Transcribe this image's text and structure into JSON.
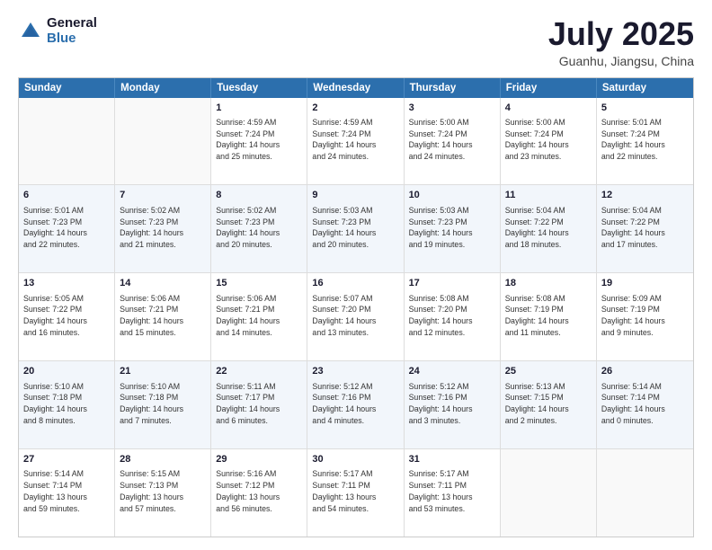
{
  "header": {
    "logo_general": "General",
    "logo_blue": "Blue",
    "title": "July 2025",
    "subtitle": "Guanhu, Jiangsu, China"
  },
  "calendar": {
    "days_of_week": [
      "Sunday",
      "Monday",
      "Tuesday",
      "Wednesday",
      "Thursday",
      "Friday",
      "Saturday"
    ],
    "weeks": [
      [
        {
          "day": "",
          "empty": true,
          "lines": []
        },
        {
          "day": "",
          "empty": true,
          "lines": []
        },
        {
          "day": "1",
          "lines": [
            "Sunrise: 4:59 AM",
            "Sunset: 7:24 PM",
            "Daylight: 14 hours",
            "and 25 minutes."
          ]
        },
        {
          "day": "2",
          "lines": [
            "Sunrise: 4:59 AM",
            "Sunset: 7:24 PM",
            "Daylight: 14 hours",
            "and 24 minutes."
          ]
        },
        {
          "day": "3",
          "lines": [
            "Sunrise: 5:00 AM",
            "Sunset: 7:24 PM",
            "Daylight: 14 hours",
            "and 24 minutes."
          ]
        },
        {
          "day": "4",
          "lines": [
            "Sunrise: 5:00 AM",
            "Sunset: 7:24 PM",
            "Daylight: 14 hours",
            "and 23 minutes."
          ]
        },
        {
          "day": "5",
          "lines": [
            "Sunrise: 5:01 AM",
            "Sunset: 7:24 PM",
            "Daylight: 14 hours",
            "and 22 minutes."
          ]
        }
      ],
      [
        {
          "day": "6",
          "lines": [
            "Sunrise: 5:01 AM",
            "Sunset: 7:23 PM",
            "Daylight: 14 hours",
            "and 22 minutes."
          ]
        },
        {
          "day": "7",
          "lines": [
            "Sunrise: 5:02 AM",
            "Sunset: 7:23 PM",
            "Daylight: 14 hours",
            "and 21 minutes."
          ]
        },
        {
          "day": "8",
          "lines": [
            "Sunrise: 5:02 AM",
            "Sunset: 7:23 PM",
            "Daylight: 14 hours",
            "and 20 minutes."
          ]
        },
        {
          "day": "9",
          "lines": [
            "Sunrise: 5:03 AM",
            "Sunset: 7:23 PM",
            "Daylight: 14 hours",
            "and 20 minutes."
          ]
        },
        {
          "day": "10",
          "lines": [
            "Sunrise: 5:03 AM",
            "Sunset: 7:23 PM",
            "Daylight: 14 hours",
            "and 19 minutes."
          ]
        },
        {
          "day": "11",
          "lines": [
            "Sunrise: 5:04 AM",
            "Sunset: 7:22 PM",
            "Daylight: 14 hours",
            "and 18 minutes."
          ]
        },
        {
          "day": "12",
          "lines": [
            "Sunrise: 5:04 AM",
            "Sunset: 7:22 PM",
            "Daylight: 14 hours",
            "and 17 minutes."
          ]
        }
      ],
      [
        {
          "day": "13",
          "lines": [
            "Sunrise: 5:05 AM",
            "Sunset: 7:22 PM",
            "Daylight: 14 hours",
            "and 16 minutes."
          ]
        },
        {
          "day": "14",
          "lines": [
            "Sunrise: 5:06 AM",
            "Sunset: 7:21 PM",
            "Daylight: 14 hours",
            "and 15 minutes."
          ]
        },
        {
          "day": "15",
          "lines": [
            "Sunrise: 5:06 AM",
            "Sunset: 7:21 PM",
            "Daylight: 14 hours",
            "and 14 minutes."
          ]
        },
        {
          "day": "16",
          "lines": [
            "Sunrise: 5:07 AM",
            "Sunset: 7:20 PM",
            "Daylight: 14 hours",
            "and 13 minutes."
          ]
        },
        {
          "day": "17",
          "lines": [
            "Sunrise: 5:08 AM",
            "Sunset: 7:20 PM",
            "Daylight: 14 hours",
            "and 12 minutes."
          ]
        },
        {
          "day": "18",
          "lines": [
            "Sunrise: 5:08 AM",
            "Sunset: 7:19 PM",
            "Daylight: 14 hours",
            "and 11 minutes."
          ]
        },
        {
          "day": "19",
          "lines": [
            "Sunrise: 5:09 AM",
            "Sunset: 7:19 PM",
            "Daylight: 14 hours",
            "and 9 minutes."
          ]
        }
      ],
      [
        {
          "day": "20",
          "lines": [
            "Sunrise: 5:10 AM",
            "Sunset: 7:18 PM",
            "Daylight: 14 hours",
            "and 8 minutes."
          ]
        },
        {
          "day": "21",
          "lines": [
            "Sunrise: 5:10 AM",
            "Sunset: 7:18 PM",
            "Daylight: 14 hours",
            "and 7 minutes."
          ]
        },
        {
          "day": "22",
          "lines": [
            "Sunrise: 5:11 AM",
            "Sunset: 7:17 PM",
            "Daylight: 14 hours",
            "and 6 minutes."
          ]
        },
        {
          "day": "23",
          "lines": [
            "Sunrise: 5:12 AM",
            "Sunset: 7:16 PM",
            "Daylight: 14 hours",
            "and 4 minutes."
          ]
        },
        {
          "day": "24",
          "lines": [
            "Sunrise: 5:12 AM",
            "Sunset: 7:16 PM",
            "Daylight: 14 hours",
            "and 3 minutes."
          ]
        },
        {
          "day": "25",
          "lines": [
            "Sunrise: 5:13 AM",
            "Sunset: 7:15 PM",
            "Daylight: 14 hours",
            "and 2 minutes."
          ]
        },
        {
          "day": "26",
          "lines": [
            "Sunrise: 5:14 AM",
            "Sunset: 7:14 PM",
            "Daylight: 14 hours",
            "and 0 minutes."
          ]
        }
      ],
      [
        {
          "day": "27",
          "lines": [
            "Sunrise: 5:14 AM",
            "Sunset: 7:14 PM",
            "Daylight: 13 hours",
            "and 59 minutes."
          ]
        },
        {
          "day": "28",
          "lines": [
            "Sunrise: 5:15 AM",
            "Sunset: 7:13 PM",
            "Daylight: 13 hours",
            "and 57 minutes."
          ]
        },
        {
          "day": "29",
          "lines": [
            "Sunrise: 5:16 AM",
            "Sunset: 7:12 PM",
            "Daylight: 13 hours",
            "and 56 minutes."
          ]
        },
        {
          "day": "30",
          "lines": [
            "Sunrise: 5:17 AM",
            "Sunset: 7:11 PM",
            "Daylight: 13 hours",
            "and 54 minutes."
          ]
        },
        {
          "day": "31",
          "lines": [
            "Sunrise: 5:17 AM",
            "Sunset: 7:11 PM",
            "Daylight: 13 hours",
            "and 53 minutes."
          ]
        },
        {
          "day": "",
          "empty": true,
          "lines": []
        },
        {
          "day": "",
          "empty": true,
          "lines": []
        }
      ]
    ]
  }
}
